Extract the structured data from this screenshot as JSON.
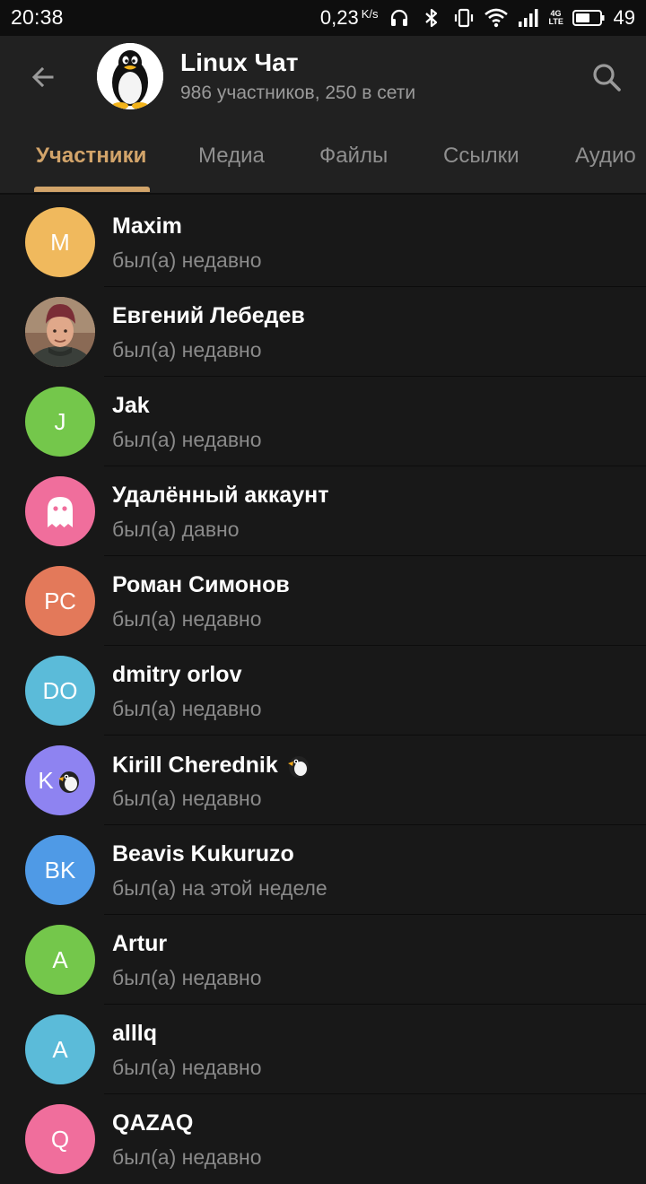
{
  "status_bar": {
    "time": "20:38",
    "net_speed": "0,23",
    "net_speed_unit": "K/s",
    "network_type": "4G",
    "network_sub": "LTE",
    "battery_percent": "49"
  },
  "header": {
    "title": "Linux Чат",
    "subtitle": "986 участников, 250 в сети",
    "back_icon": "arrow-left-icon",
    "search_icon": "search-icon"
  },
  "tabs": [
    {
      "label": "Участники",
      "active": true
    },
    {
      "label": "Медиа",
      "active": false
    },
    {
      "label": "Файлы",
      "active": false
    },
    {
      "label": "Ссылки",
      "active": false
    },
    {
      "label": "Аудио",
      "active": false
    }
  ],
  "colors": {
    "accent": "#d2a46a",
    "background": "#181818",
    "header": "#212121"
  },
  "members": [
    {
      "name": "Maxim",
      "status": "был(а) недавно",
      "initials": "M",
      "color": "#f0b95d"
    },
    {
      "name": "Евгений Лебедев",
      "status": "был(а) недавно",
      "initials": "",
      "color": "#6b4a3e",
      "photo": true
    },
    {
      "name": "Jak",
      "status": "был(а) недавно",
      "initials": "J",
      "color": "#74c74b"
    },
    {
      "name": "Удалённый аккаунт",
      "status": "был(а) давно",
      "initials": "",
      "color": "#f06e9c",
      "ghost": true
    },
    {
      "name": "Роман Симонов",
      "status": "был(а) недавно",
      "initials": "РС",
      "color": "#e3795a"
    },
    {
      "name": "dmitry orlov",
      "status": "был(а) недавно",
      "initials": "DO",
      "color": "#5bbbd9"
    },
    {
      "name": "Kirill Cherednik",
      "status": "был(а) недавно",
      "initials": "K",
      "color": "#8e83f1",
      "penguin": true
    },
    {
      "name": "Beavis Kukuruzo",
      "status": "был(а) на этой неделе",
      "initials": "BK",
      "color": "#4f9ae6"
    },
    {
      "name": "Artur",
      "status": "был(а) недавно",
      "initials": "A",
      "color": "#74c74b"
    },
    {
      "name": "alllq",
      "status": "был(а) недавно",
      "initials": "A",
      "color": "#5bbbd9"
    },
    {
      "name": "QAZAQ",
      "status": "был(а) недавно",
      "initials": "Q",
      "color": "#f06e9c"
    }
  ]
}
